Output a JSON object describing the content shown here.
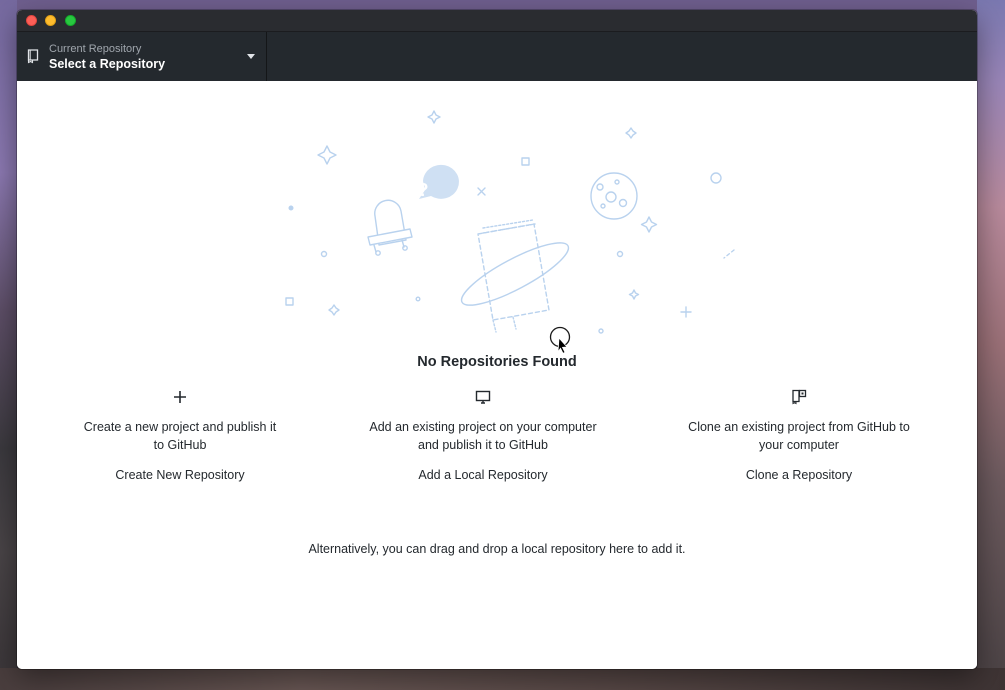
{
  "toolbar": {
    "repo_caption": "Current Repository",
    "repo_value": "Select a Repository"
  },
  "empty_state": {
    "title": "No Repositories Found",
    "actions": [
      {
        "icon": "plus-icon",
        "description_line1": "Create a new project and publish it",
        "description_line2": "to GitHub",
        "link": "Create New Repository"
      },
      {
        "icon": "desktop-computer-icon",
        "description_line1": "Add an existing project on your computer",
        "description_line2": "and publish it to GitHub",
        "link": "Add a Local Repository"
      },
      {
        "icon": "clone-repo-icon",
        "description_line1": "Clone an existing project from GitHub to",
        "description_line2": "your computer",
        "link": "Clone a Repository"
      }
    ],
    "drag_hint": "Alternatively, you can drag and drop a local repository here to add it."
  },
  "colors": {
    "toolbar_bg": "#24292e",
    "illustration_stroke": "#b9d2ee",
    "illustration_fill": "#cfe0f3",
    "text": "#24292e"
  }
}
